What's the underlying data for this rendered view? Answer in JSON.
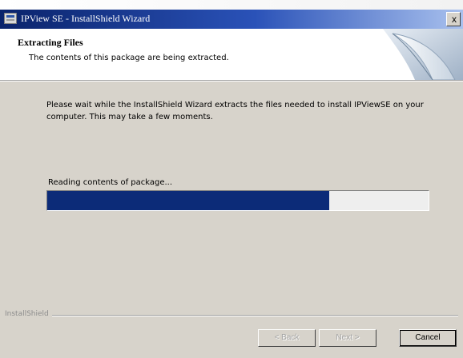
{
  "window": {
    "title": "IPView SE - InstallShield Wizard",
    "close_label": "x"
  },
  "header": {
    "title": "Extracting Files",
    "subtitle": "The contents of this package are being extracted."
  },
  "body": {
    "message": "Please wait while the InstallShield Wizard extracts the files needed to install IPViewSE on your computer.  This may take a few moments."
  },
  "progress": {
    "label": "Reading contents of package...",
    "fraction": 0.74
  },
  "footer": {
    "brand": "InstallShield",
    "back_label": "< Back",
    "next_label": "Next >",
    "cancel_label": "Cancel"
  },
  "colors": {
    "titlebar_start": "#0a236b",
    "progress_fill": "#0c2b78",
    "dialog_background": "#d7d3cb"
  },
  "icons": {
    "app": "installer-app-icon",
    "close": "close-icon",
    "header_graphic": "page-curl-graphic"
  }
}
